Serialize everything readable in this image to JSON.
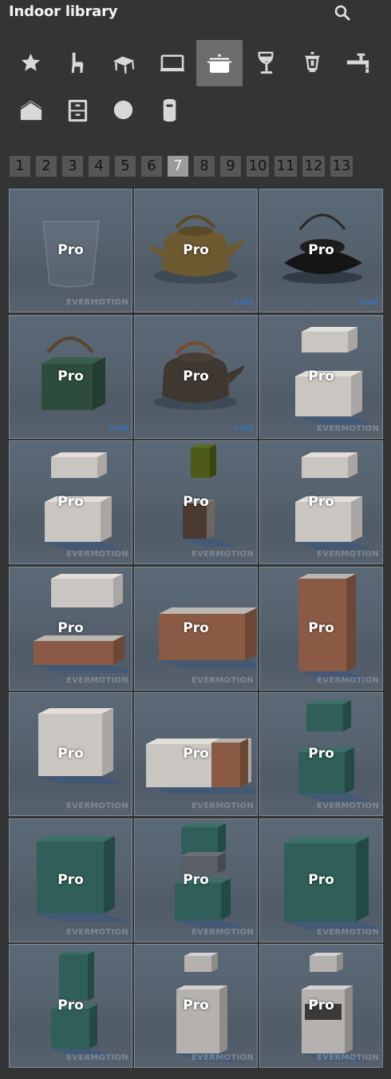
{
  "header": {
    "title": "Indoor library",
    "search_icon": "search-icon"
  },
  "categories": [
    {
      "name": "favorites",
      "icon": "star-icon",
      "active": false
    },
    {
      "name": "chairs",
      "icon": "chair-icon",
      "active": false
    },
    {
      "name": "tables",
      "icon": "table-icon",
      "active": false
    },
    {
      "name": "electronics",
      "icon": "monitor-icon",
      "active": false
    },
    {
      "name": "kitchen",
      "icon": "pot-icon",
      "active": true
    },
    {
      "name": "tableware",
      "icon": "wine-glass-icon",
      "active": false
    },
    {
      "name": "lighting",
      "icon": "lantern-icon",
      "active": false
    },
    {
      "name": "bathroom",
      "icon": "faucet-icon",
      "active": false
    },
    {
      "name": "architecture",
      "icon": "house-icon",
      "active": false
    },
    {
      "name": "cabinets",
      "icon": "cabinet-icon",
      "active": false
    },
    {
      "name": "decor",
      "icon": "circle-icon",
      "active": false
    },
    {
      "name": "misc",
      "icon": "cylinder-icon",
      "active": false
    }
  ],
  "pagination": {
    "pages": [
      "1",
      "2",
      "3",
      "4",
      "5",
      "6",
      "7",
      "8",
      "9",
      "10",
      "11",
      "12",
      "13"
    ],
    "current": "7"
  },
  "items": [
    {
      "art": "glass",
      "badge": "Pro",
      "watermark": "EVERMOTION"
    },
    {
      "art": "teapot-brown",
      "badge": "Pro",
      "watermark": "FINE"
    },
    {
      "art": "teapot-black",
      "badge": "Pro",
      "watermark": "FINE"
    },
    {
      "art": "teapot-green",
      "badge": "Pro",
      "watermark": "FINE"
    },
    {
      "art": "teapot-dark",
      "badge": "Pro",
      "watermark": "FINE"
    },
    {
      "art": "cabinet-white",
      "badge": "Pro",
      "watermark": "EVERMOTION"
    },
    {
      "art": "cabinet-white",
      "badge": "Pro",
      "watermark": "EVERMOTION"
    },
    {
      "art": "cabinet-tall-olive",
      "badge": "Pro",
      "watermark": "EVERMOTION"
    },
    {
      "art": "cabinet-white",
      "badge": "Pro",
      "watermark": "EVERMOTION"
    },
    {
      "art": "cabinet-wood-low",
      "badge": "Pro",
      "watermark": "EVERMOTION"
    },
    {
      "art": "cabinet-wood-long",
      "badge": "Pro",
      "watermark": "EVERMOTION"
    },
    {
      "art": "cabinet-wood-tall",
      "badge": "Pro",
      "watermark": "EVERMOTION"
    },
    {
      "art": "cabinet-white-tall",
      "badge": "Pro",
      "watermark": "EVERMOTION"
    },
    {
      "art": "cabinet-white-corner",
      "badge": "Pro",
      "watermark": "EVERMOTION"
    },
    {
      "art": "cabinet-teal-pair",
      "badge": "Pro",
      "watermark": "EVERMOTION"
    },
    {
      "art": "cabinet-teal-wide",
      "badge": "Pro",
      "watermark": "EVERMOTION"
    },
    {
      "art": "cabinet-teal-shelves",
      "badge": "Pro",
      "watermark": "EVERMOTION"
    },
    {
      "art": "cabinet-teal-big",
      "badge": "Pro",
      "watermark": "EVERMOTION"
    },
    {
      "art": "cabinet-teal-stack",
      "badge": "Pro",
      "watermark": "EVERMOTION"
    },
    {
      "art": "cabinet-grey-stack",
      "badge": "Pro",
      "watermark": "EVERMOTION"
    },
    {
      "art": "cabinet-oven",
      "badge": "Pro",
      "watermark": "EVERMOTION"
    }
  ]
}
